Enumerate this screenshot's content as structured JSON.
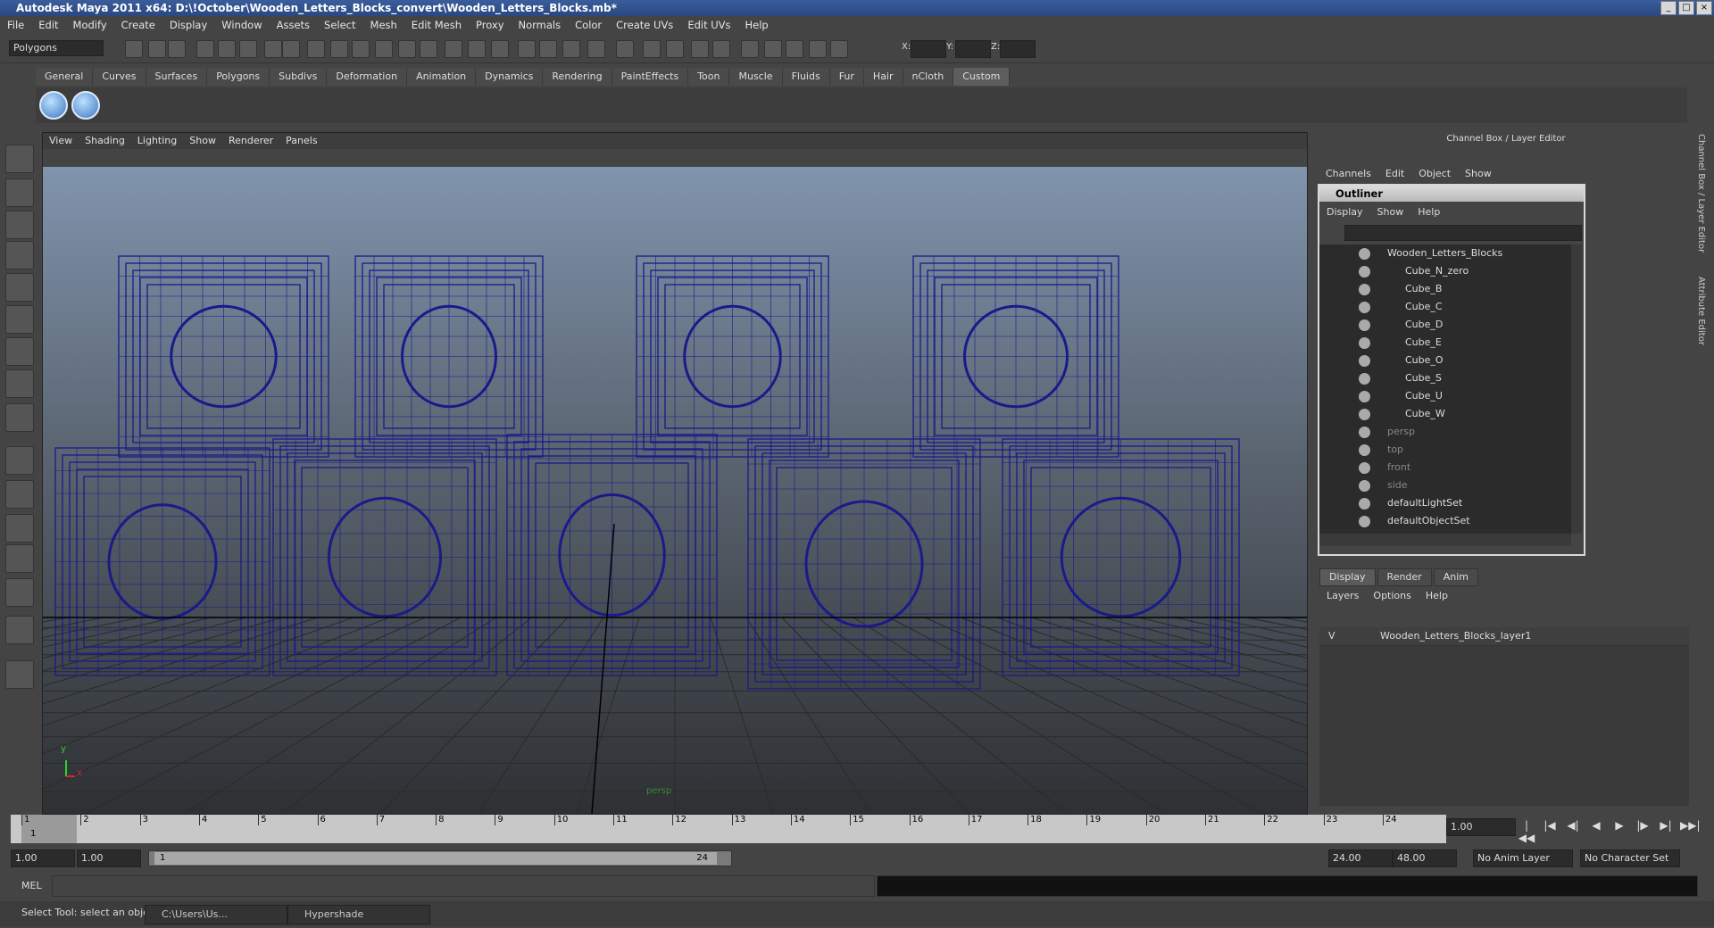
{
  "window": {
    "title": "Autodesk Maya 2011 x64: D:\\!October\\Wooden_Letters_Blocks_convert\\Wooden_Letters_Blocks.mb*"
  },
  "menubar": [
    "File",
    "Edit",
    "Modify",
    "Create",
    "Display",
    "Window",
    "Assets",
    "Select",
    "Mesh",
    "Edit Mesh",
    "Proxy",
    "Normals",
    "Color",
    "Create UVs",
    "Edit UVs",
    "Help"
  ],
  "status": {
    "mode": "Polygons",
    "x_label": "X:",
    "y_label": "Y:",
    "z_label": "Z:"
  },
  "shelf": {
    "tabs": [
      "General",
      "Curves",
      "Surfaces",
      "Polygons",
      "Subdivs",
      "Deformation",
      "Animation",
      "Dynamics",
      "Rendering",
      "PaintEffects",
      "Toon",
      "Muscle",
      "Fluids",
      "Fur",
      "Hair",
      "nCloth",
      "Custom"
    ],
    "active": "Custom"
  },
  "viewport": {
    "menu": [
      "View",
      "Shading",
      "Lighting",
      "Show",
      "Renderer",
      "Panels"
    ],
    "camera_label": "persp",
    "axis_y": "y",
    "axis_x": "x",
    "wire_color": "#1a1a8a"
  },
  "channelbox": {
    "title": "Channel Box / Layer Editor",
    "menu": [
      "Channels",
      "Edit",
      "Object",
      "Show"
    ]
  },
  "outliner": {
    "title": "Outliner",
    "menu": [
      "Display",
      "Show",
      "Help"
    ],
    "items": [
      {
        "label": "Wooden_Letters_Blocks",
        "indent": 0
      },
      {
        "label": "Cube_N_zero",
        "indent": 1
      },
      {
        "label": "Cube_B",
        "indent": 1
      },
      {
        "label": "Cube_C",
        "indent": 1
      },
      {
        "label": "Cube_D",
        "indent": 1
      },
      {
        "label": "Cube_E",
        "indent": 1
      },
      {
        "label": "Cube_O",
        "indent": 1
      },
      {
        "label": "Cube_S",
        "indent": 1
      },
      {
        "label": "Cube_U",
        "indent": 1
      },
      {
        "label": "Cube_W",
        "indent": 1
      },
      {
        "label": "persp",
        "indent": 0,
        "dim": true
      },
      {
        "label": "top",
        "indent": 0,
        "dim": true
      },
      {
        "label": "front",
        "indent": 0,
        "dim": true
      },
      {
        "label": "side",
        "indent": 0,
        "dim": true
      },
      {
        "label": "defaultLightSet",
        "indent": 0
      },
      {
        "label": "defaultObjectSet",
        "indent": 0
      }
    ]
  },
  "layers": {
    "tabs": [
      "Display",
      "Render",
      "Anim"
    ],
    "active": "Display",
    "menu": [
      "Layers",
      "Options",
      "Help"
    ],
    "row_vis": "V",
    "row_name": "Wooden_Letters_Blocks_layer1"
  },
  "side_tabs": [
    "Channel Box / Layer Editor",
    "Attribute Editor"
  ],
  "timeline": {
    "ticks": [
      "1",
      "2",
      "3",
      "4",
      "5",
      "6",
      "7",
      "8",
      "9",
      "10",
      "11",
      "12",
      "13",
      "14",
      "15",
      "16",
      "17",
      "18",
      "19",
      "20",
      "21",
      "22",
      "23",
      "24"
    ],
    "current_marker": "1",
    "current_frame": "1.00"
  },
  "range": {
    "start": "1.00",
    "playback_start": "1.00",
    "slider_start": "1",
    "slider_end": "24",
    "playback_end": "24.00",
    "end": "48.00",
    "anim_layer": "No Anim Layer",
    "char_set": "No Character Set"
  },
  "mel": {
    "label": "MEL"
  },
  "help": {
    "text": "Select Tool: select an object"
  },
  "taskbar": [
    {
      "label": "C:\\Users\\Us..."
    },
    {
      "label": "Hypershade"
    }
  ]
}
